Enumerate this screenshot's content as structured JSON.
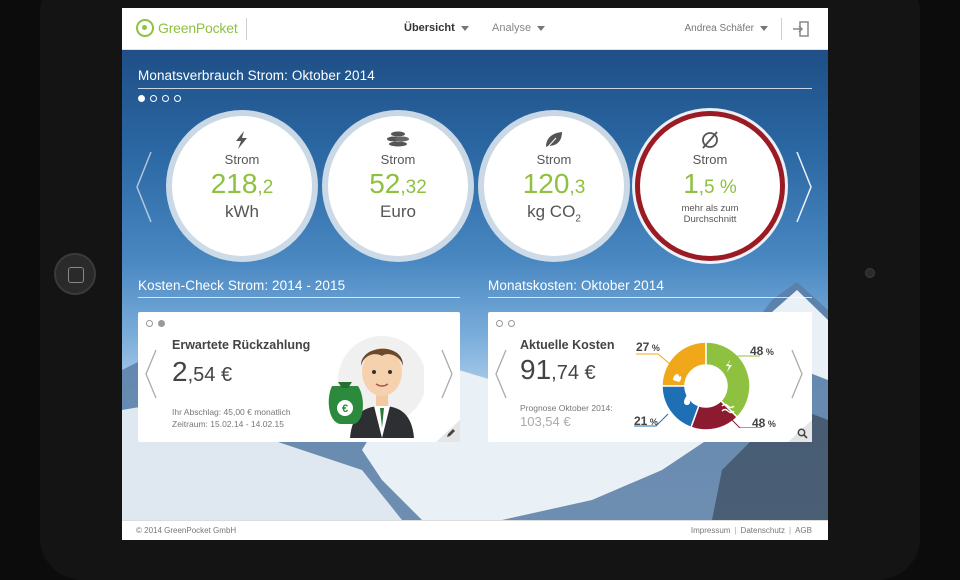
{
  "header": {
    "brand": "GreenPocket",
    "nav": [
      {
        "label": "Übersicht",
        "active": true
      },
      {
        "label": "Analyse",
        "active": false
      }
    ],
    "user": "Andrea Schäfer",
    "logout_icon": "logout-icon"
  },
  "overview": {
    "title": "Monatsverbrauch Strom: Oktober 2014",
    "pager_active": 1,
    "pager_count": 4,
    "tiles": [
      {
        "icon": "lightning-icon",
        "label": "Strom",
        "value_int": "218",
        "value_dec": ",2",
        "unit": "kWh"
      },
      {
        "icon": "coins-icon",
        "label": "Strom",
        "value_int": "52",
        "value_dec": ",32",
        "unit": "Euro"
      },
      {
        "icon": "leaf-icon",
        "label": "Strom",
        "value_int": "120",
        "value_dec": ",3",
        "unit": "kg CO",
        "unit_sub": "2"
      },
      {
        "icon": "average-icon",
        "label": "Strom",
        "value_int": "1",
        "value_dec": ",5 %",
        "note": "mehr als zum Durchschnitt",
        "alert_color": "#9b1b24"
      }
    ]
  },
  "cost_check": {
    "title": "Kosten-Check Strom: 2014 - 2015",
    "card_title": "Erwartete Rückzahlung",
    "value_int": "2",
    "value_dec": ",54 €",
    "line1": "Ihr Abschlag: 45,00 € monatlich",
    "line2": "Zeitraum: 15.02.14 - 14.02.15",
    "edit_icon": "pencil-icon"
  },
  "monthly_cost": {
    "title": "Monatskosten: Oktober 2014",
    "card_title": "Aktuelle Kosten",
    "value_int": "91",
    "value_dec": ",74 €",
    "forecast_label": "Prognose Oktober 2014:",
    "forecast_value": "103,54 €",
    "zoom_icon": "magnifier-icon",
    "donut": [
      {
        "pct": "27",
        "color": "#f0a81a",
        "icon": "flame-icon"
      },
      {
        "pct": "48",
        "color": "#8dc13f",
        "icon": "lightning-icon"
      },
      {
        "pct": "48",
        "color": "#8c1b2f",
        "icon": "heat-icon"
      },
      {
        "pct": "21",
        "color": "#1f6fb5",
        "icon": "water-icon"
      }
    ],
    "percent_sign": "%"
  },
  "footer": {
    "copyright": "© 2014 GreenPocket GmbH",
    "links": [
      "Impressum",
      "Datenschutz",
      "AGB"
    ]
  },
  "colors": {
    "accent": "#8dc13f",
    "alert": "#9b1b24"
  }
}
